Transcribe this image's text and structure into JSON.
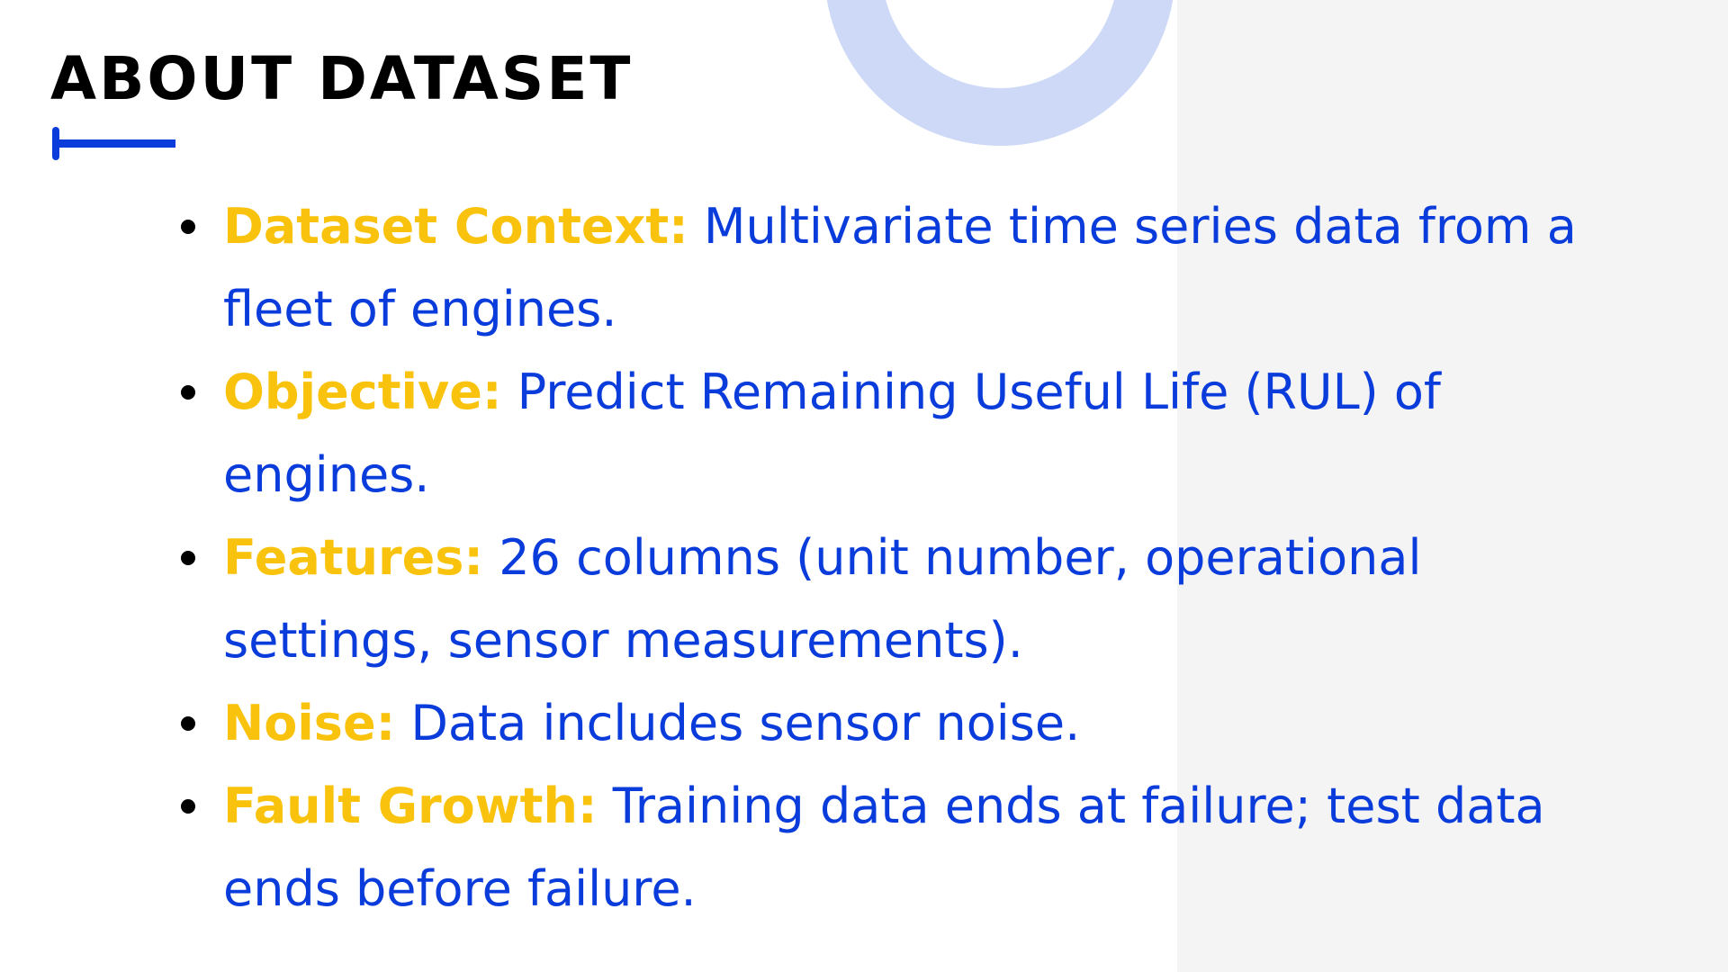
{
  "title": "ABOUT DATASET",
  "colors": {
    "accent_blue": "#0a3cdc",
    "label_yellow": "#f9c30d",
    "ring_light_blue": "#cdd9f7",
    "panel_gray": "#f4f4f4"
  },
  "bullets": [
    {
      "label": "Dataset Context:",
      "text": "Multivariate time series data from a fleet of engines."
    },
    {
      "label": "Objective:",
      "text": "Predict Remaining Useful Life (RUL) of engines."
    },
    {
      "label": "Features:",
      "text": "26 columns (unit number, operational settings, sensor measurements)."
    },
    {
      "label": "Noise:",
      "text": "Data includes sensor noise."
    },
    {
      "label": "Fault Growth:",
      "text": "Training data ends at failure; test data ends before failure."
    }
  ]
}
